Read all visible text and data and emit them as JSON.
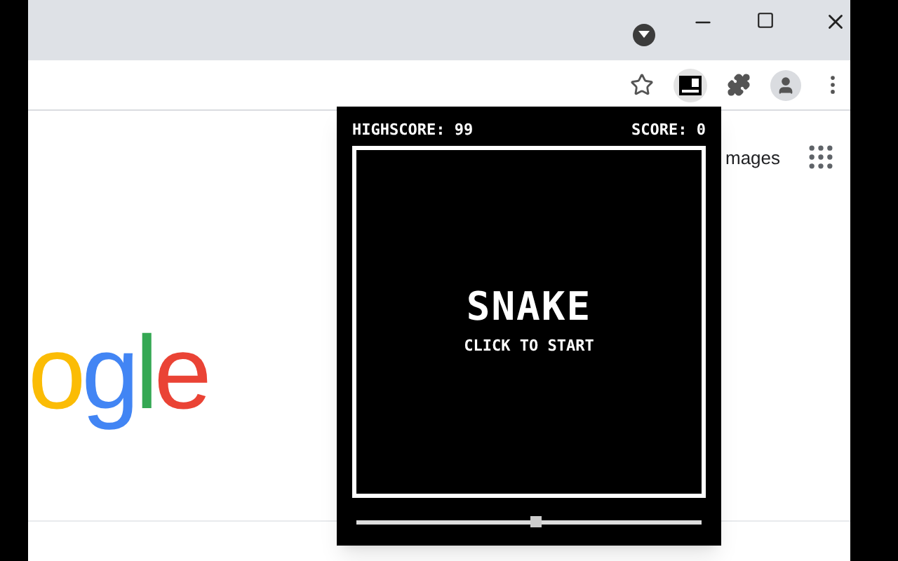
{
  "page": {
    "images_link": "mages",
    "logo_letters": [
      {
        "text": "o",
        "color": "#fbbc05"
      },
      {
        "text": "g",
        "color": "#4285f4"
      },
      {
        "text": "l",
        "color": "#34a853"
      },
      {
        "text": "e",
        "color": "#ea4335"
      }
    ]
  },
  "popup": {
    "highscore": "HIGHSCORE: 99",
    "score": "SCORE: 0",
    "title": "SNAKE",
    "subtitle": "CLICK TO START",
    "speed": {
      "level": 0.52
    }
  }
}
